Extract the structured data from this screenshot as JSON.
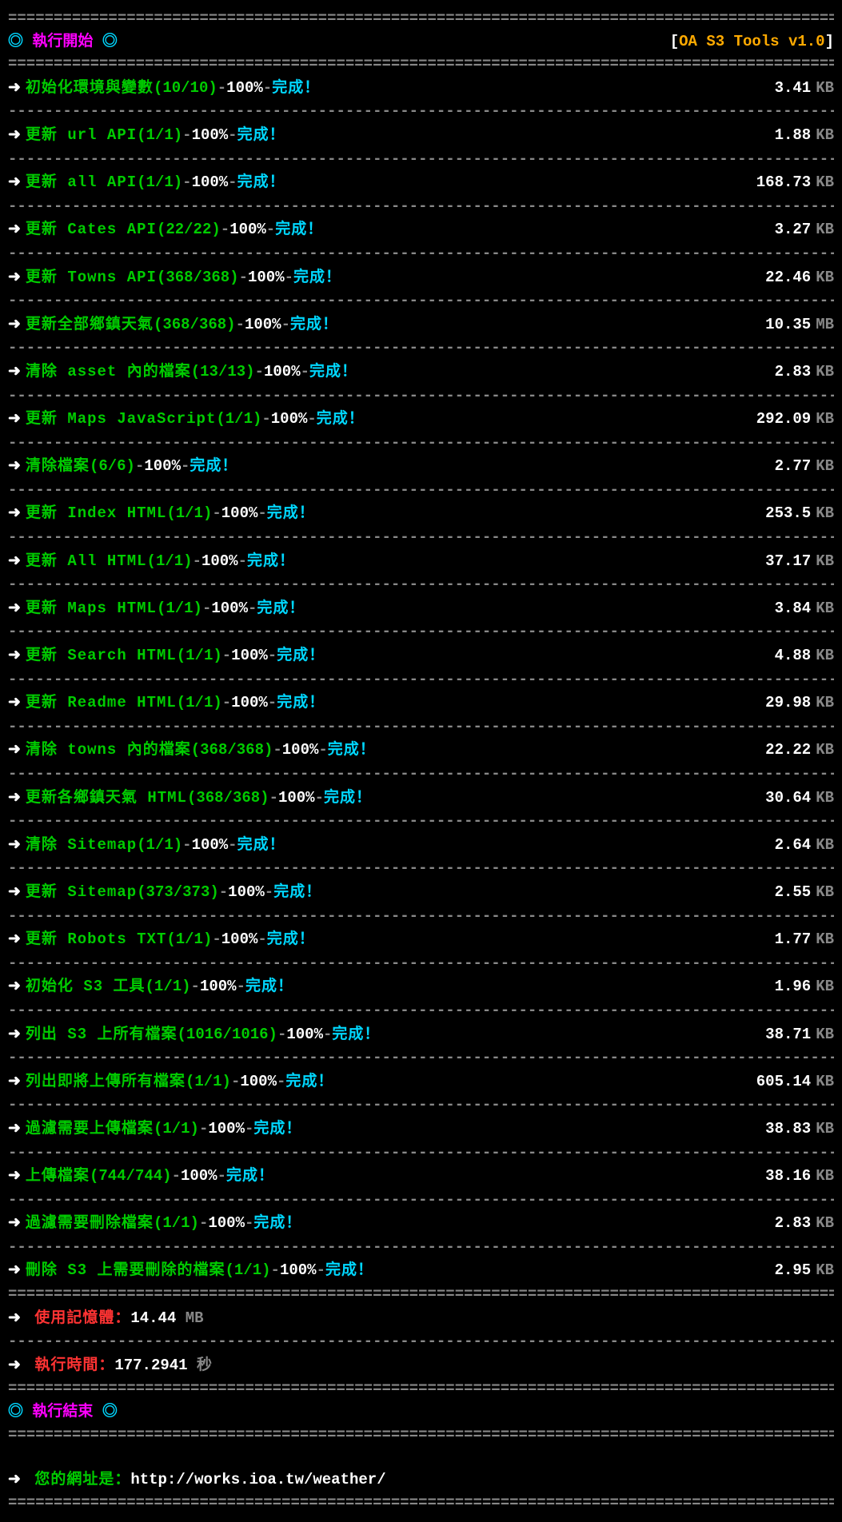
{
  "header": {
    "bullet": "◎",
    "start_title": "執行開始",
    "tools_label": "OA S3 Tools v1.0"
  },
  "divider_double": "==================================================================================================",
  "divider_single": "--------------------------------------------------------------------------------------------------",
  "arrow": "➜",
  "dash_sep": " - ",
  "pct_label": "100%",
  "done_label": "完成！",
  "tasks": [
    {
      "name": "初始化環境與變數",
      "count": "(10/10)",
      "size": "3.41",
      "unit": "KB"
    },
    {
      "name": "更新 url API",
      "count": "(1/1)",
      "size": "1.88",
      "unit": "KB"
    },
    {
      "name": "更新 all API",
      "count": "(1/1)",
      "size": "168.73",
      "unit": "KB"
    },
    {
      "name": "更新 Cates API",
      "count": "(22/22)",
      "size": "3.27",
      "unit": "KB"
    },
    {
      "name": "更新 Towns API",
      "count": "(368/368)",
      "size": "22.46",
      "unit": "KB"
    },
    {
      "name": "更新全部鄉鎮天氣",
      "count": "(368/368)",
      "size": "10.35",
      "unit": "MB"
    },
    {
      "name": "清除 asset 內的檔案",
      "count": "(13/13)",
      "size": "2.83",
      "unit": "KB"
    },
    {
      "name": "更新 Maps JavaScript",
      "count": "(1/1)",
      "size": "292.09",
      "unit": "KB"
    },
    {
      "name": "清除檔案",
      "count": "(6/6)",
      "size": "2.77",
      "unit": "KB"
    },
    {
      "name": "更新 Index HTML",
      "count": "(1/1)",
      "size": "253.5",
      "unit": "KB"
    },
    {
      "name": "更新 All HTML",
      "count": "(1/1)",
      "size": "37.17",
      "unit": "KB"
    },
    {
      "name": "更新 Maps HTML",
      "count": "(1/1)",
      "size": "3.84",
      "unit": "KB"
    },
    {
      "name": "更新 Search HTML",
      "count": "(1/1)",
      "size": "4.88",
      "unit": "KB"
    },
    {
      "name": "更新 Readme HTML",
      "count": "(1/1)",
      "size": "29.98",
      "unit": "KB"
    },
    {
      "name": "清除 towns 內的檔案",
      "count": "(368/368)",
      "size": "22.22",
      "unit": "KB"
    },
    {
      "name": "更新各鄉鎮天氣 HTML",
      "count": "(368/368)",
      "size": "30.64",
      "unit": "KB"
    },
    {
      "name": "清除 Sitemap",
      "count": "(1/1)",
      "size": "2.64",
      "unit": "KB"
    },
    {
      "name": "更新 Sitemap",
      "count": "(373/373)",
      "size": "2.55",
      "unit": "KB"
    },
    {
      "name": "更新 Robots TXT",
      "count": "(1/1)",
      "size": "1.77",
      "unit": "KB"
    },
    {
      "name": "初始化 S3 工具",
      "count": "(1/1)",
      "size": "1.96",
      "unit": "KB"
    },
    {
      "name": "列出 S3 上所有檔案",
      "count": "(1016/1016)",
      "size": "38.71",
      "unit": "KB"
    },
    {
      "name": "列出即將上傳所有檔案",
      "count": "(1/1)",
      "size": "605.14",
      "unit": "KB"
    },
    {
      "name": "過濾需要上傳檔案",
      "count": "(1/1)",
      "size": "38.83",
      "unit": "KB"
    },
    {
      "name": "上傳檔案",
      "count": "(744/744)",
      "size": "38.16",
      "unit": "KB"
    },
    {
      "name": "過濾需要刪除檔案",
      "count": "(1/1)",
      "size": "2.83",
      "unit": "KB"
    },
    {
      "name": "刪除 S3 上需要刪除的檔案",
      "count": "(1/1)",
      "size": "2.95",
      "unit": "KB"
    }
  ],
  "summary": {
    "memory_label": "使用記憶體：",
    "memory_value": "14.44",
    "memory_unit": " MB",
    "time_label": "執行時間：",
    "time_value": "177.2941",
    "time_unit": " 秒"
  },
  "footer": {
    "end_title": "執行結束",
    "url_label": "您的網址是：",
    "url_value": "http://works.ioa.tw/weather/"
  }
}
